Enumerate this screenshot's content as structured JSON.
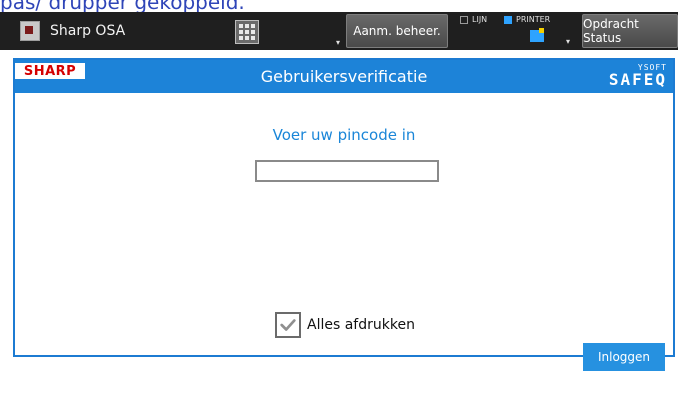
{
  "top_overlay": {
    "text": "pas/ drupper gekoppeld."
  },
  "header": {
    "app_title": "Sharp OSA",
    "account_button": "Aanm. beheer.",
    "status": {
      "line_label": "LIJN",
      "printer_label": "PRINTER"
    },
    "job_status_button": "Opdracht Status"
  },
  "panel": {
    "brand": "SHARP",
    "title": "Gebruikersverificatie",
    "safeq_small": "YSOFT",
    "safeq_big": "SAFEQ",
    "pin_prompt": "Voer uw pincode in",
    "pin_value": "",
    "print_all_label": "Alles afdrukken",
    "print_all_checked": true,
    "login_button": "Inloggen"
  },
  "colors": {
    "accent_blue": "#1d83d8",
    "topbar_bg": "#1f1f1f",
    "brand_red": "#d50000",
    "printer_blue": "#2ea3ff"
  },
  "icons": {
    "app": "sharp-osa-icon",
    "keypad": "keypad-icon",
    "printer": "printer-icon",
    "checkbox": "checkmark-icon"
  }
}
